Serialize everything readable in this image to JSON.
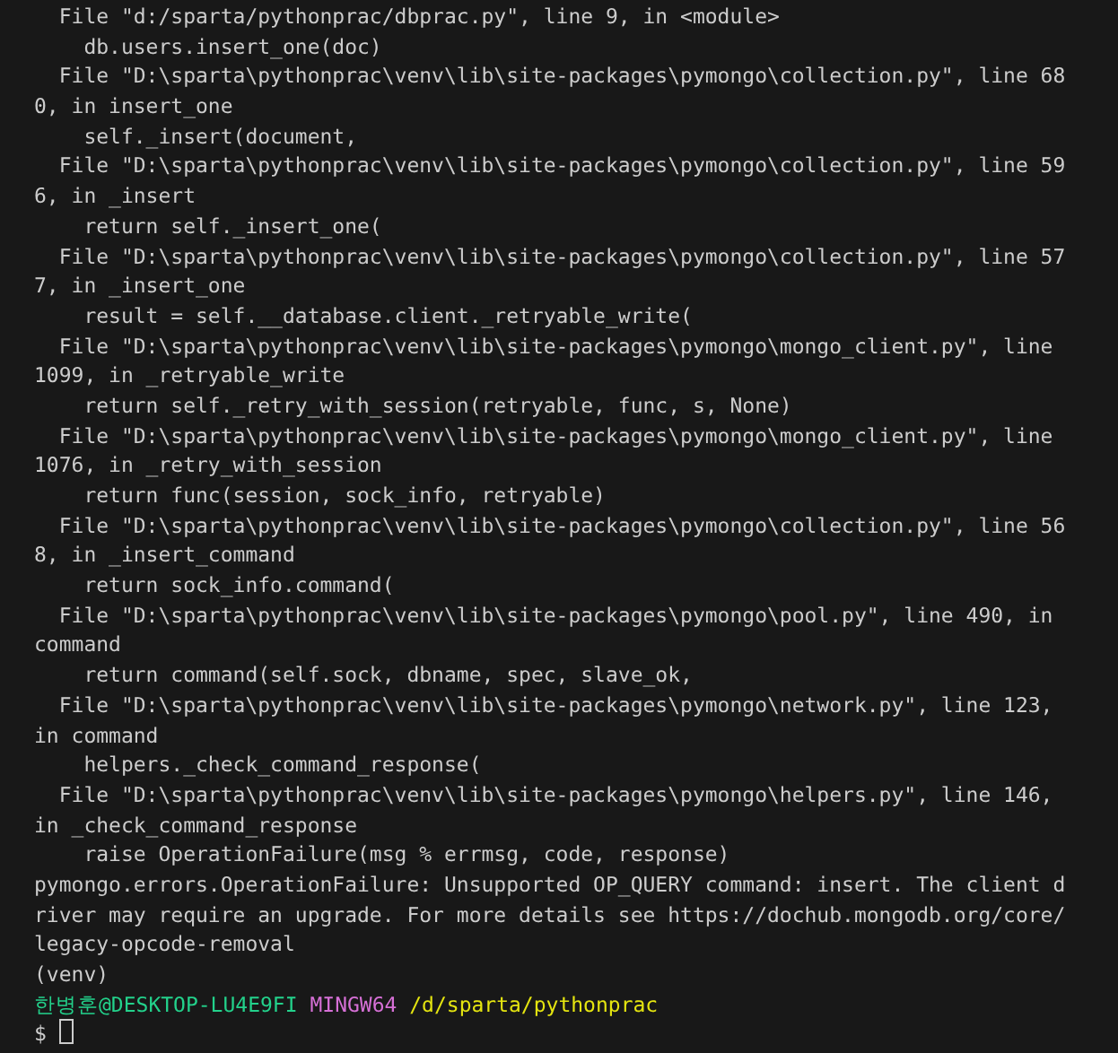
{
  "terminal": {
    "lines": [
      "  File \"d:/sparta/pythonprac/dbprac.py\", line 9, in <module>",
      "    db.users.insert_one(doc)",
      "  File \"D:\\sparta\\pythonprac\\venv\\lib\\site-packages\\pymongo\\collection.py\", line 68",
      "0, in insert_one",
      "    self._insert(document,",
      "  File \"D:\\sparta\\pythonprac\\venv\\lib\\site-packages\\pymongo\\collection.py\", line 59",
      "6, in _insert",
      "    return self._insert_one(",
      "  File \"D:\\sparta\\pythonprac\\venv\\lib\\site-packages\\pymongo\\collection.py\", line 57",
      "7, in _insert_one",
      "    result = self.__database.client._retryable_write(",
      "  File \"D:\\sparta\\pythonprac\\venv\\lib\\site-packages\\pymongo\\mongo_client.py\", line",
      "1099, in _retryable_write",
      "    return self._retry_with_session(retryable, func, s, None)",
      "  File \"D:\\sparta\\pythonprac\\venv\\lib\\site-packages\\pymongo\\mongo_client.py\", line",
      "1076, in _retry_with_session",
      "    return func(session, sock_info, retryable)",
      "  File \"D:\\sparta\\pythonprac\\venv\\lib\\site-packages\\pymongo\\collection.py\", line 56",
      "8, in _insert_command",
      "    return sock_info.command(",
      "  File \"D:\\sparta\\pythonprac\\venv\\lib\\site-packages\\pymongo\\pool.py\", line 490, in",
      "command",
      "    return command(self.sock, dbname, spec, slave_ok,",
      "  File \"D:\\sparta\\pythonprac\\venv\\lib\\site-packages\\pymongo\\network.py\", line 123,",
      "in command",
      "    helpers._check_command_response(",
      "  File \"D:\\sparta\\pythonprac\\venv\\lib\\site-packages\\pymongo\\helpers.py\", line 146,",
      "in _check_command_response",
      "    raise OperationFailure(msg % errmsg, code, response)",
      "pymongo.errors.OperationFailure: Unsupported OP_QUERY command: insert. The client d",
      "river may require an upgrade. For more details see https://dochub.mongodb.org/core/",
      "legacy-opcode-removal",
      "(venv)"
    ],
    "prompt": {
      "user_host": "한병훈@DESKTOP-LU4E9FI",
      "system": "MINGW64",
      "path": "/d/sparta/pythonprac"
    },
    "input_line": {
      "symbol": "$"
    }
  }
}
